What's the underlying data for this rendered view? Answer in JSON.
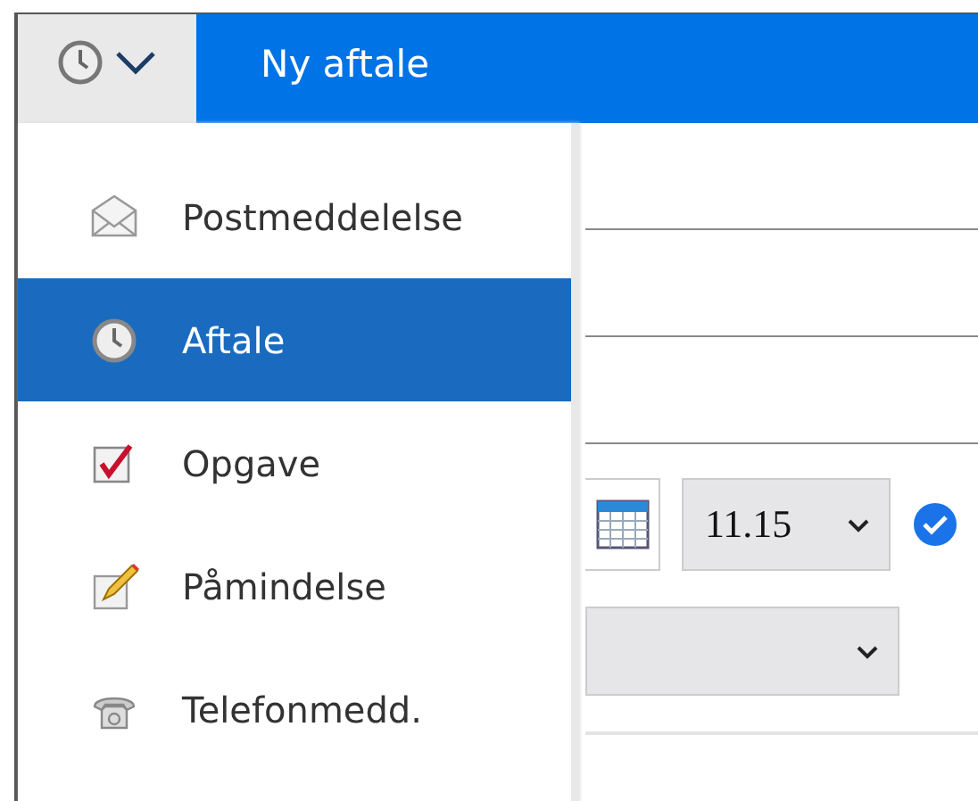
{
  "header": {
    "title": "Ny aftale"
  },
  "menu": {
    "items": [
      {
        "kind": "mail",
        "label": "Postmeddelelse",
        "selected": false
      },
      {
        "kind": "appointment",
        "label": "Aftale",
        "selected": true
      },
      {
        "kind": "task",
        "label": "Opgave",
        "selected": false
      },
      {
        "kind": "reminder",
        "label": "Påmindelse",
        "selected": false
      },
      {
        "kind": "phone",
        "label": "Telefonmedd.",
        "selected": false
      }
    ]
  },
  "form": {
    "time": {
      "value": "11.15"
    },
    "checkbox": {
      "checked": true
    }
  }
}
